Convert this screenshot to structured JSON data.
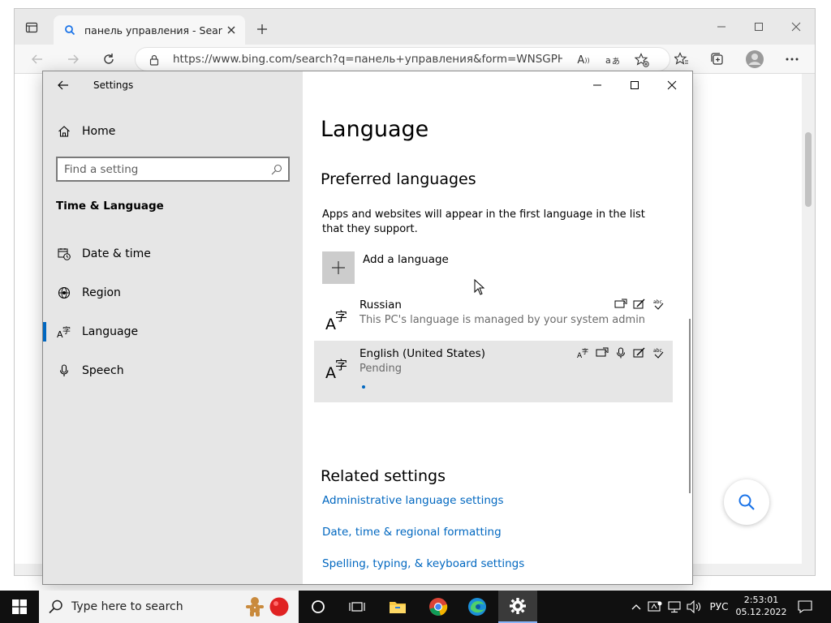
{
  "browser": {
    "tab_title": "панель управления - Search",
    "url": "https://www.bing.com/search?q=панель+управления&form=WNSGPH&qs..."
  },
  "settings": {
    "window_title": "Settings",
    "sidebar": {
      "home_label": "Home",
      "search_placeholder": "Find a setting",
      "section_title": "Time & Language",
      "items": [
        {
          "label": "Date & time",
          "icon": "calendar-clock-icon"
        },
        {
          "label": "Region",
          "icon": "globe-icon"
        },
        {
          "label": "Language",
          "icon": "language-icon",
          "active": true
        },
        {
          "label": "Speech",
          "icon": "microphone-icon"
        }
      ]
    },
    "main": {
      "title": "Language",
      "preferred_heading": "Preferred languages",
      "description": "Apps and websites will appear in the first language in the list that they support.",
      "add_language_label": "Add a language",
      "languages": [
        {
          "name": "Russian",
          "status": "This PC's language is managed by your system admin"
        },
        {
          "name": "English (United States)",
          "status": "Pending"
        }
      ],
      "related_heading": "Related settings",
      "links": [
        "Administrative language settings",
        "Date, time & regional formatting",
        "Spelling, typing, & keyboard settings"
      ]
    }
  },
  "taskbar": {
    "search_placeholder": "Type here to search",
    "language_indicator": "РУС",
    "time": "2:53:01",
    "date": "05.12.2022"
  },
  "colors": {
    "accent": "#0067c0",
    "taskbar": "#101010"
  }
}
